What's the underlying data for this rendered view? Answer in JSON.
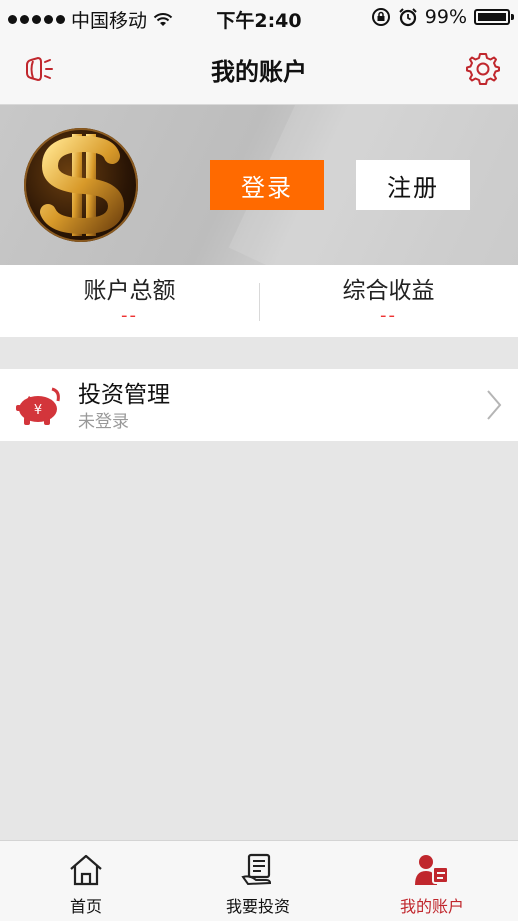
{
  "status_bar": {
    "carrier": "中国移动",
    "time": "下午2:40",
    "battery": "99%",
    "battery_level": 0.99
  },
  "nav": {
    "title": "我的账户",
    "left_icon": "speaker-icon",
    "right_icon": "gear-icon"
  },
  "header": {
    "avatar": "dollar-sign-avatar",
    "login_label": "登录",
    "register_label": "注册",
    "login_color": "#ff6a00"
  },
  "stats": [
    {
      "label": "账户总额",
      "value": "--"
    },
    {
      "label": "综合收益",
      "value": "--"
    }
  ],
  "menu": [
    {
      "title": "投资管理",
      "subtitle": "未登录",
      "icon": "piggy-bank-icon"
    }
  ],
  "tabs": [
    {
      "label": "首页",
      "icon": "home-icon",
      "active": false
    },
    {
      "label": "我要投资",
      "icon": "invest-icon",
      "active": false
    },
    {
      "label": "我的账户",
      "icon": "account-icon",
      "active": true
    }
  ],
  "colors": {
    "accent": "#c0272d",
    "value_red": "#e33333"
  }
}
